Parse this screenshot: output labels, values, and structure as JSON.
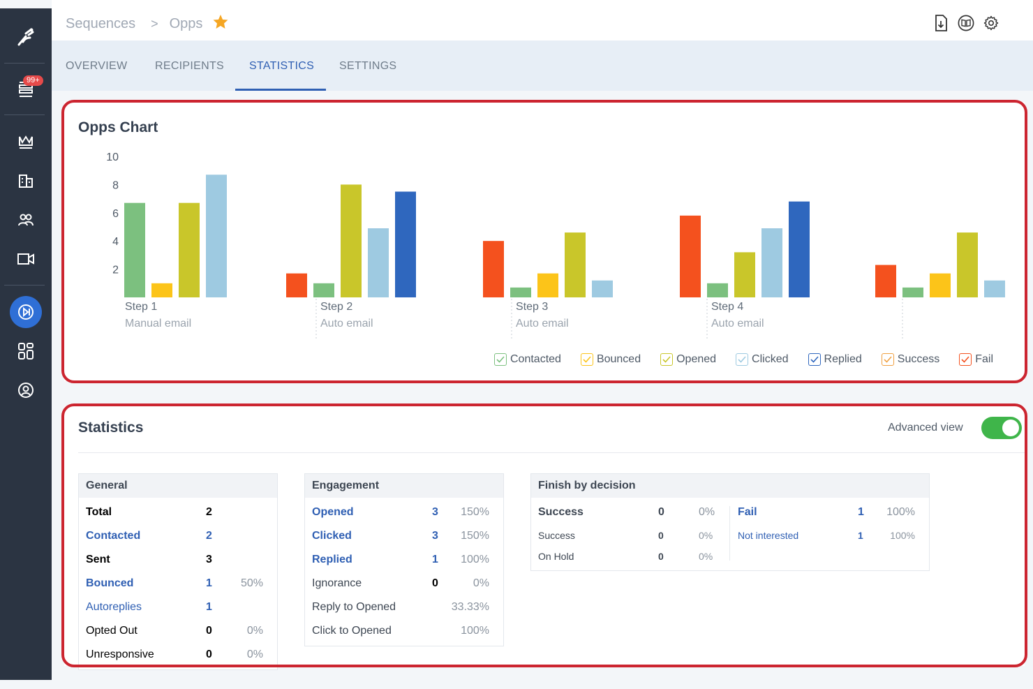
{
  "breadcrumb": {
    "root": "Sequences",
    "separator": ">",
    "current": "Opps"
  },
  "tabs": [
    "OVERVIEW",
    "RECIPIENTS",
    "STATISTICS",
    "SETTINGS"
  ],
  "active_tab": "STATISTICS",
  "sidebar": {
    "badge": "99+"
  },
  "chart_panel": {
    "title": "Opps Chart"
  },
  "chart_data": {
    "type": "bar",
    "categories": [
      {
        "step": "Step 1",
        "type": "Manual email"
      },
      {
        "step": "Step 2",
        "type": "Auto email"
      },
      {
        "step": "Step 3",
        "type": "Auto email"
      },
      {
        "step": "Step 4",
        "type": "Auto email"
      },
      {
        "step": "",
        "type": ""
      }
    ],
    "y_ticks": [
      "10",
      "8",
      "6",
      "4",
      "2"
    ],
    "ylim": [
      0,
      10
    ],
    "series": [
      {
        "name": "Contacted",
        "color": "#7cc07f",
        "values": [
          6.7,
          1.0,
          0.7,
          1.0,
          0.7
        ]
      },
      {
        "name": "Bounced",
        "color": "#fcc419",
        "values": [
          1.0,
          null,
          1.7,
          null,
          1.7
        ]
      },
      {
        "name": "Opened",
        "color": "#c9c62a",
        "values": [
          6.7,
          8.0,
          4.6,
          3.2,
          4.6
        ]
      },
      {
        "name": "Clicked",
        "color": "#9ecae1",
        "values": [
          8.7,
          4.9,
          1.2,
          4.9,
          1.2
        ]
      },
      {
        "name": "Replied",
        "color": "#2f67be",
        "values": [
          null,
          7.5,
          null,
          6.8,
          null
        ]
      },
      {
        "name": "Success",
        "color": "#f0a040",
        "values": [
          null,
          null,
          null,
          null,
          null
        ]
      },
      {
        "name": "Fail",
        "color": "#f4511e",
        "values": [
          null,
          1.7,
          4.0,
          5.8,
          2.3
        ]
      }
    ],
    "grid": false,
    "legend_position": "bottom-right"
  },
  "legend": [
    {
      "label": "Contacted",
      "color": "#7cc07f"
    },
    {
      "label": "Bounced",
      "color": "#fcc419"
    },
    {
      "label": "Opened",
      "color": "#c9c62a"
    },
    {
      "label": "Clicked",
      "color": "#9ecae1"
    },
    {
      "label": "Replied",
      "color": "#2f67be"
    },
    {
      "label": "Success",
      "color": "#f0a040"
    },
    {
      "label": "Fail",
      "color": "#f4511e"
    }
  ],
  "statistics": {
    "title": "Statistics",
    "advanced_view_label": "Advanced view",
    "advanced_view_on": true,
    "general": {
      "title": "General",
      "rows": [
        {
          "label": "Total",
          "count": "2",
          "pct": ""
        },
        {
          "label": "Contacted",
          "count": "2",
          "pct": ""
        },
        {
          "label": "Sent",
          "count": "3",
          "pct": ""
        },
        {
          "label": "Bounced",
          "count": "1",
          "pct": "50%"
        },
        {
          "label": "Autoreplies",
          "count": "1",
          "pct": ""
        },
        {
          "label": "Opted Out",
          "count": "0",
          "pct": "0%"
        },
        {
          "label": "Unresponsive",
          "count": "0",
          "pct": "0%"
        }
      ]
    },
    "engagement": {
      "title": "Engagement",
      "rows": [
        {
          "label": "Opened",
          "count": "3",
          "pct": "150%"
        },
        {
          "label": "Clicked",
          "count": "3",
          "pct": "150%"
        },
        {
          "label": "Replied",
          "count": "1",
          "pct": "100%"
        },
        {
          "label": "Ignorance",
          "count": "0",
          "pct": "0%"
        },
        {
          "label": "Reply to Opened",
          "count": "",
          "pct": "33.33%"
        },
        {
          "label": "Click to Opened",
          "count": "",
          "pct": "100%"
        }
      ]
    },
    "finish": {
      "title": "Finish by decision",
      "left": [
        {
          "label": "Success",
          "count": "0",
          "pct": "0%"
        },
        {
          "label": "Success",
          "count": "0",
          "pct": "0%"
        },
        {
          "label": "On Hold",
          "count": "0",
          "pct": "0%"
        }
      ],
      "right": [
        {
          "label": "Fail",
          "count": "1",
          "pct": "100%"
        },
        {
          "label": "Not interested",
          "count": "1",
          "pct": "100%"
        }
      ]
    }
  }
}
